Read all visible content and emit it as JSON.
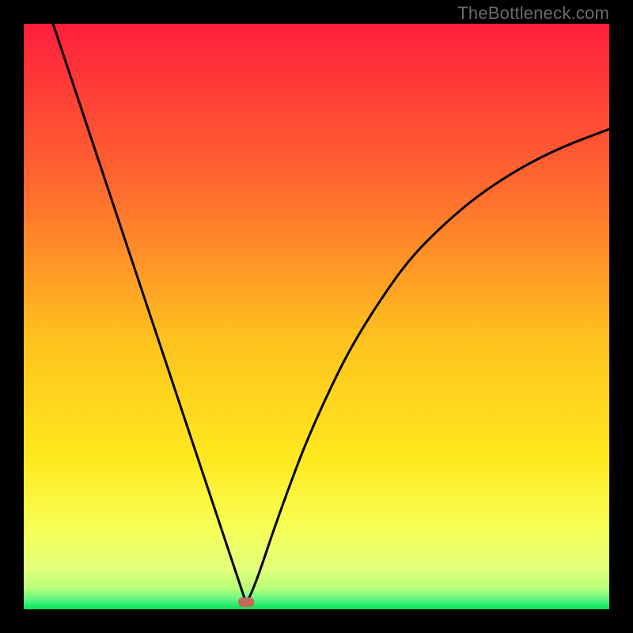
{
  "watermark": "TheBottleneck.com",
  "chart_data": {
    "type": "line",
    "title": "",
    "xlabel": "",
    "ylabel": "",
    "xlim": [
      0,
      100
    ],
    "ylim": [
      0,
      100
    ],
    "optimum_x": 38,
    "background_gradient": {
      "top": "#ff1e3c",
      "mid_upper": "#ff8a2a",
      "mid": "#ffe81e",
      "mid_lower": "#f7ff6a",
      "band": "#d8ff80",
      "bottom": "#00e55a"
    },
    "marker": {
      "x": 38,
      "y": 1.2,
      "color": "#c36a5a"
    },
    "series": [
      {
        "name": "left-branch",
        "x": [
          5,
          8,
          11,
          14,
          17,
          20,
          23,
          26,
          29,
          32,
          35,
          36.5,
          37.5,
          38
        ],
        "y": [
          100,
          91,
          82,
          73,
          64,
          55,
          46,
          37,
          28,
          19,
          10,
          5.5,
          2.5,
          1
        ]
      },
      {
        "name": "right-branch",
        "x": [
          38,
          39,
          40.5,
          42.5,
          45,
          48,
          52,
          56,
          61,
          66,
          72,
          78,
          85,
          92,
          100
        ],
        "y": [
          1,
          3,
          7,
          13,
          20,
          28,
          37,
          45,
          53,
          60,
          66,
          71,
          75.5,
          79,
          82
        ]
      }
    ]
  }
}
